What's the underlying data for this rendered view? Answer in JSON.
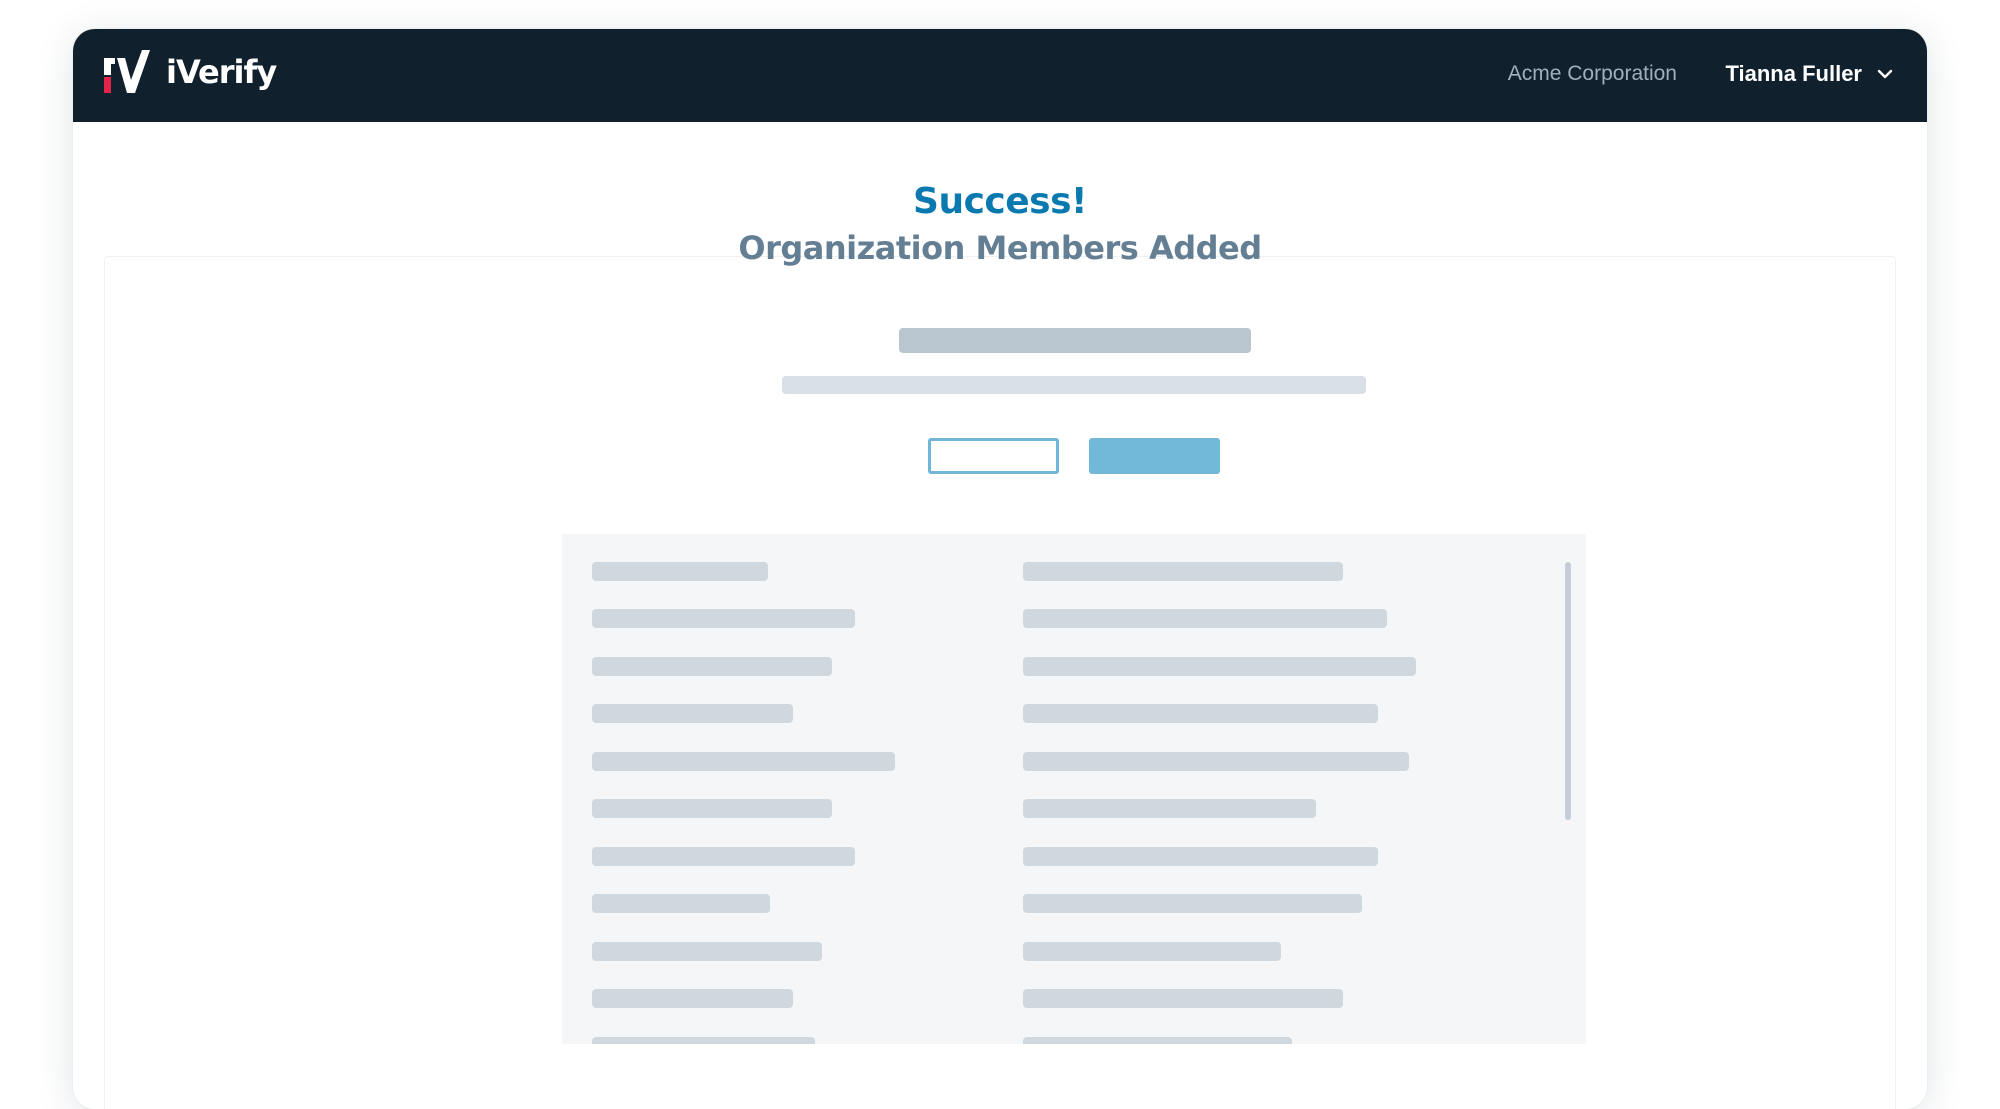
{
  "header": {
    "brand": "iVerify",
    "organization": "Acme Corporation",
    "user": "Tianna Fuller",
    "logo_icon": "iverify-logo-icon",
    "menu_icon": "chevron-down-icon"
  },
  "main": {
    "title": "Success!",
    "subtitle": "Organization Members Added"
  },
  "colors": {
    "header_bg": "#11202d",
    "accent": "#0a79b0",
    "subtitle": "#647f94",
    "logo_red": "#e0244a",
    "button": "#72b8d9"
  }
}
